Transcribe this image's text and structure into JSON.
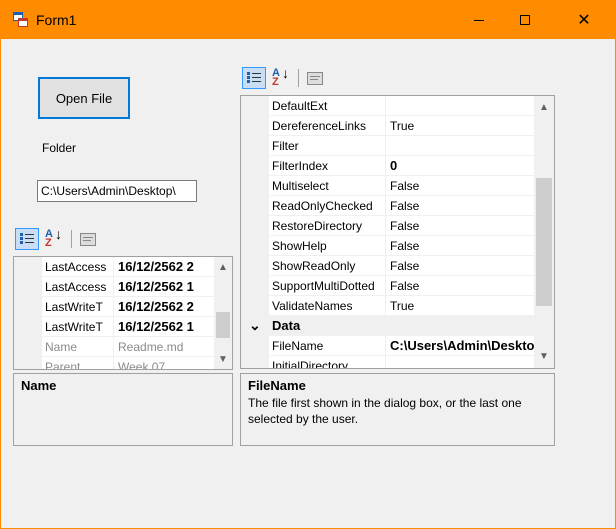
{
  "window": {
    "title": "Form1",
    "titlebar_color": "#FF8C00",
    "icons": [
      "app-icon",
      "minimize-icon",
      "maximize-icon",
      "close-icon"
    ],
    "close_glyph": "✕"
  },
  "form": {
    "open_button": "Open File",
    "folder_label": "Folder",
    "path_value": "C:\\Users\\Admin\\Desktop\\"
  },
  "small_grid": {
    "rows": [
      {
        "name": "LastAccess",
        "value": "16/12/2562 2",
        "style": "bold"
      },
      {
        "name": "LastAccess",
        "value": "16/12/2562 1",
        "style": "bold"
      },
      {
        "name": "LastWriteT",
        "value": "16/12/2562 2",
        "style": "bold"
      },
      {
        "name": "LastWriteT",
        "value": "16/12/2562 1",
        "style": "bold"
      },
      {
        "name": "Name",
        "value": "Readme.md",
        "style": "grey"
      },
      {
        "name": "Parent",
        "value": "Week 07",
        "style": "grey"
      }
    ],
    "help_title": "Name",
    "help_desc": ""
  },
  "large_grid": {
    "rows": [
      {
        "name": "DefaultExt",
        "value": "",
        "style": ""
      },
      {
        "name": "DereferenceLinks",
        "value": "True",
        "style": ""
      },
      {
        "name": "Filter",
        "value": "",
        "style": ""
      },
      {
        "name": "FilterIndex",
        "value": "0",
        "style": "bold"
      },
      {
        "name": "Multiselect",
        "value": "False",
        "style": ""
      },
      {
        "name": "ReadOnlyChecked",
        "value": "False",
        "style": ""
      },
      {
        "name": "RestoreDirectory",
        "value": "False",
        "style": ""
      },
      {
        "name": "ShowHelp",
        "value": "False",
        "style": ""
      },
      {
        "name": "ShowReadOnly",
        "value": "False",
        "style": ""
      },
      {
        "name": "SupportMultiDotted",
        "value": "False",
        "style": ""
      },
      {
        "name": "ValidateNames",
        "value": "True",
        "style": ""
      }
    ],
    "category": {
      "expander": "⌄",
      "label": "Data"
    },
    "rows_after": [
      {
        "name": "FileName",
        "value": "C:\\Users\\Admin\\Desktop\\",
        "style": "bold"
      },
      {
        "name": "InitialDirectory",
        "value": "",
        "style": ""
      }
    ],
    "help_title": "FileName",
    "help_desc": "The file first shown in the dialog box, or the last one selected by the user."
  },
  "scroll_glyphs": {
    "up": "▲",
    "down": "▼"
  }
}
